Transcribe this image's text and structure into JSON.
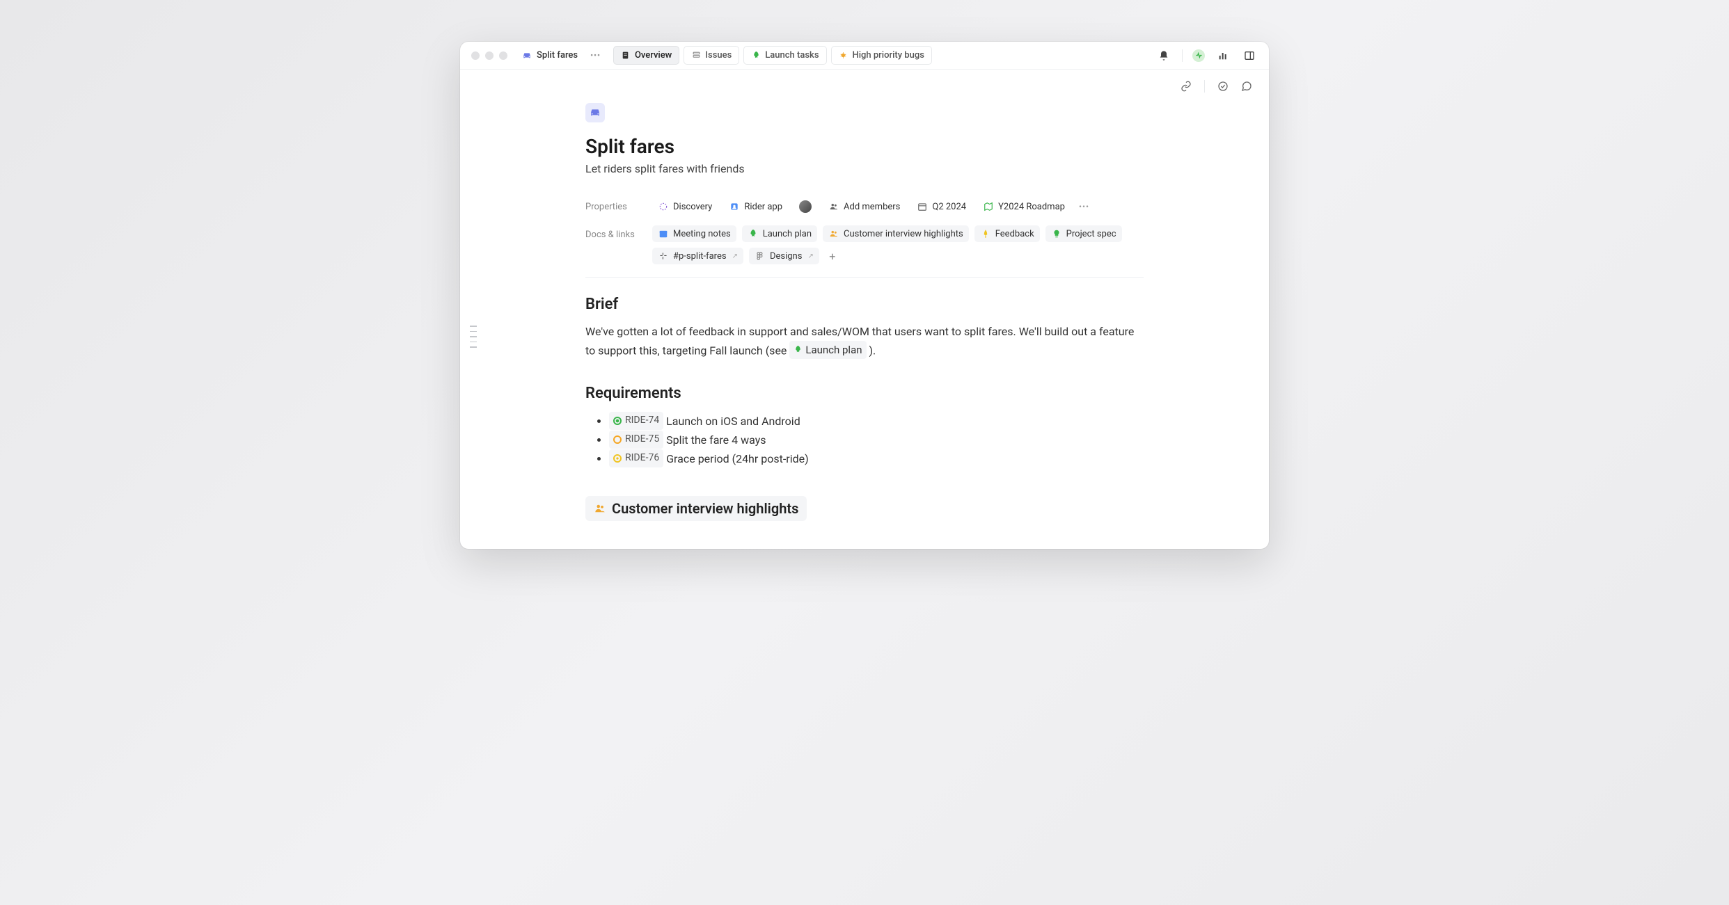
{
  "breadcrumb": {
    "title": "Split fares"
  },
  "tabs": [
    {
      "label": "Overview"
    },
    {
      "label": "Issues"
    },
    {
      "label": "Launch tasks"
    },
    {
      "label": "High priority bugs"
    }
  ],
  "page": {
    "title": "Split fares",
    "subtitle": "Let riders split fares with friends"
  },
  "properties": {
    "label": "Properties",
    "status": "Discovery",
    "team": "Rider app",
    "add_members": "Add members",
    "target": "Q2 2024",
    "roadmap": "Y2024 Roadmap"
  },
  "docs": {
    "label": "Docs & links",
    "items": [
      {
        "label": "Meeting notes",
        "icon": "calendar-icon",
        "color": "#4c8df6"
      },
      {
        "label": "Launch plan",
        "icon": "rocket-icon",
        "color": "#39b54a"
      },
      {
        "label": "Customer interview highlights",
        "icon": "people-icon",
        "color": "#f0a830"
      },
      {
        "label": "Feedback",
        "icon": "pin-icon",
        "color": "#f0c420"
      },
      {
        "label": "Project spec",
        "icon": "bulb-icon",
        "color": "#39b54a"
      },
      {
        "label": "#p-split-fares",
        "icon": "slack-icon",
        "external": true
      },
      {
        "label": "Designs",
        "icon": "figma-icon",
        "external": true
      }
    ]
  },
  "brief": {
    "heading": "Brief",
    "text_before": "We've gotten a lot of feedback in support and sales/WOM that users want to split fares. We'll build out a feature to support this, targeting Fall launch (see ",
    "inline_doc": "Launch plan",
    "text_after": " )."
  },
  "requirements": {
    "heading": "Requirements",
    "items": [
      {
        "id": "RIDE-74",
        "text": "Launch on iOS and Android",
        "status": "green"
      },
      {
        "id": "RIDE-75",
        "text": "Split the fare 4 ways",
        "status": "orange"
      },
      {
        "id": "RIDE-76",
        "text": "Grace period (24hr post-ride)",
        "status": "yellow"
      }
    ]
  },
  "embed": {
    "heading": "Customer interview highlights"
  }
}
